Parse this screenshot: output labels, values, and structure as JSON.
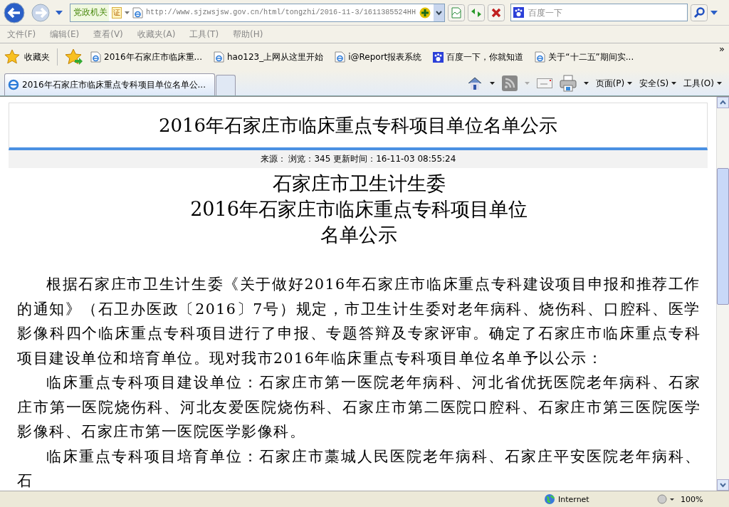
{
  "address_bar": {
    "tag": "党政机关",
    "badge": "证",
    "url": "http://www.sjzwsjsw.gov.cn/html/tongzhi/2016-11-3/1611385524HH"
  },
  "search": {
    "placeholder": "百度一下"
  },
  "menu": [
    "文件(F)",
    "编辑(E)",
    "查看(V)",
    "收藏夹(A)",
    "工具(T)",
    "帮助(H)"
  ],
  "favorites_bar": {
    "label": "收藏夹",
    "links": [
      {
        "kind": "page",
        "label": "2016年石家庄市临床重..."
      },
      {
        "kind": "page",
        "label": "hao123_上网从这里开始"
      },
      {
        "kind": "page",
        "label": "i@Report报表系统"
      },
      {
        "kind": "paw",
        "label": "百度一下，你就知道"
      },
      {
        "kind": "page",
        "label": "关于“十二五”期间实..."
      }
    ],
    "more": "»"
  },
  "tabs": [
    {
      "label": "2016年石家庄市临床重点专科项目单位名单公...",
      "selected": true
    }
  ],
  "command_bar": [
    "页面(P)",
    "安全(S)",
    "工具(O)"
  ],
  "article": {
    "title": "2016年石家庄市临床重点专科项目单位名单公示",
    "meta": "来源： 浏览：345 更新时间：16-11-03 08:55:24",
    "heading": [
      "石家庄市卫生计生委",
      "2016年石家庄市临床重点专科项目单位",
      "名单公示"
    ],
    "paragraphs": [
      "根据石家庄市卫生计生委《关于做好2016年石家庄市临床重点专科建设项目申报和推荐工作的通知》（石卫办医政〔2016〕7号）规定，市卫生计生委对老年病科、烧伤科、口腔科、医学影像科四个临床重点专科项目进行了申报、专题答辩及专家评审。确定了石家庄市临床重点专科项目建设单位和培育单位。现对我市2016年临床重点专科项目单位名单予以公示：",
      "临床重点专科项目建设单位：石家庄市第一医院老年病科、河北省优抚医院老年病科、石家庄市第一医院烧伤科、河北友爱医院烧伤科、石家庄市第二医院口腔科、石家庄市第三医院医学影像科、石家庄市第一医院医学影像科。",
      "临床重点专科项目培育单位：石家庄市藁城人民医院老年病科、石家庄平安医院老年病科、石"
    ]
  },
  "status_bar": {
    "zone": "Internet",
    "zoom": "100%"
  }
}
